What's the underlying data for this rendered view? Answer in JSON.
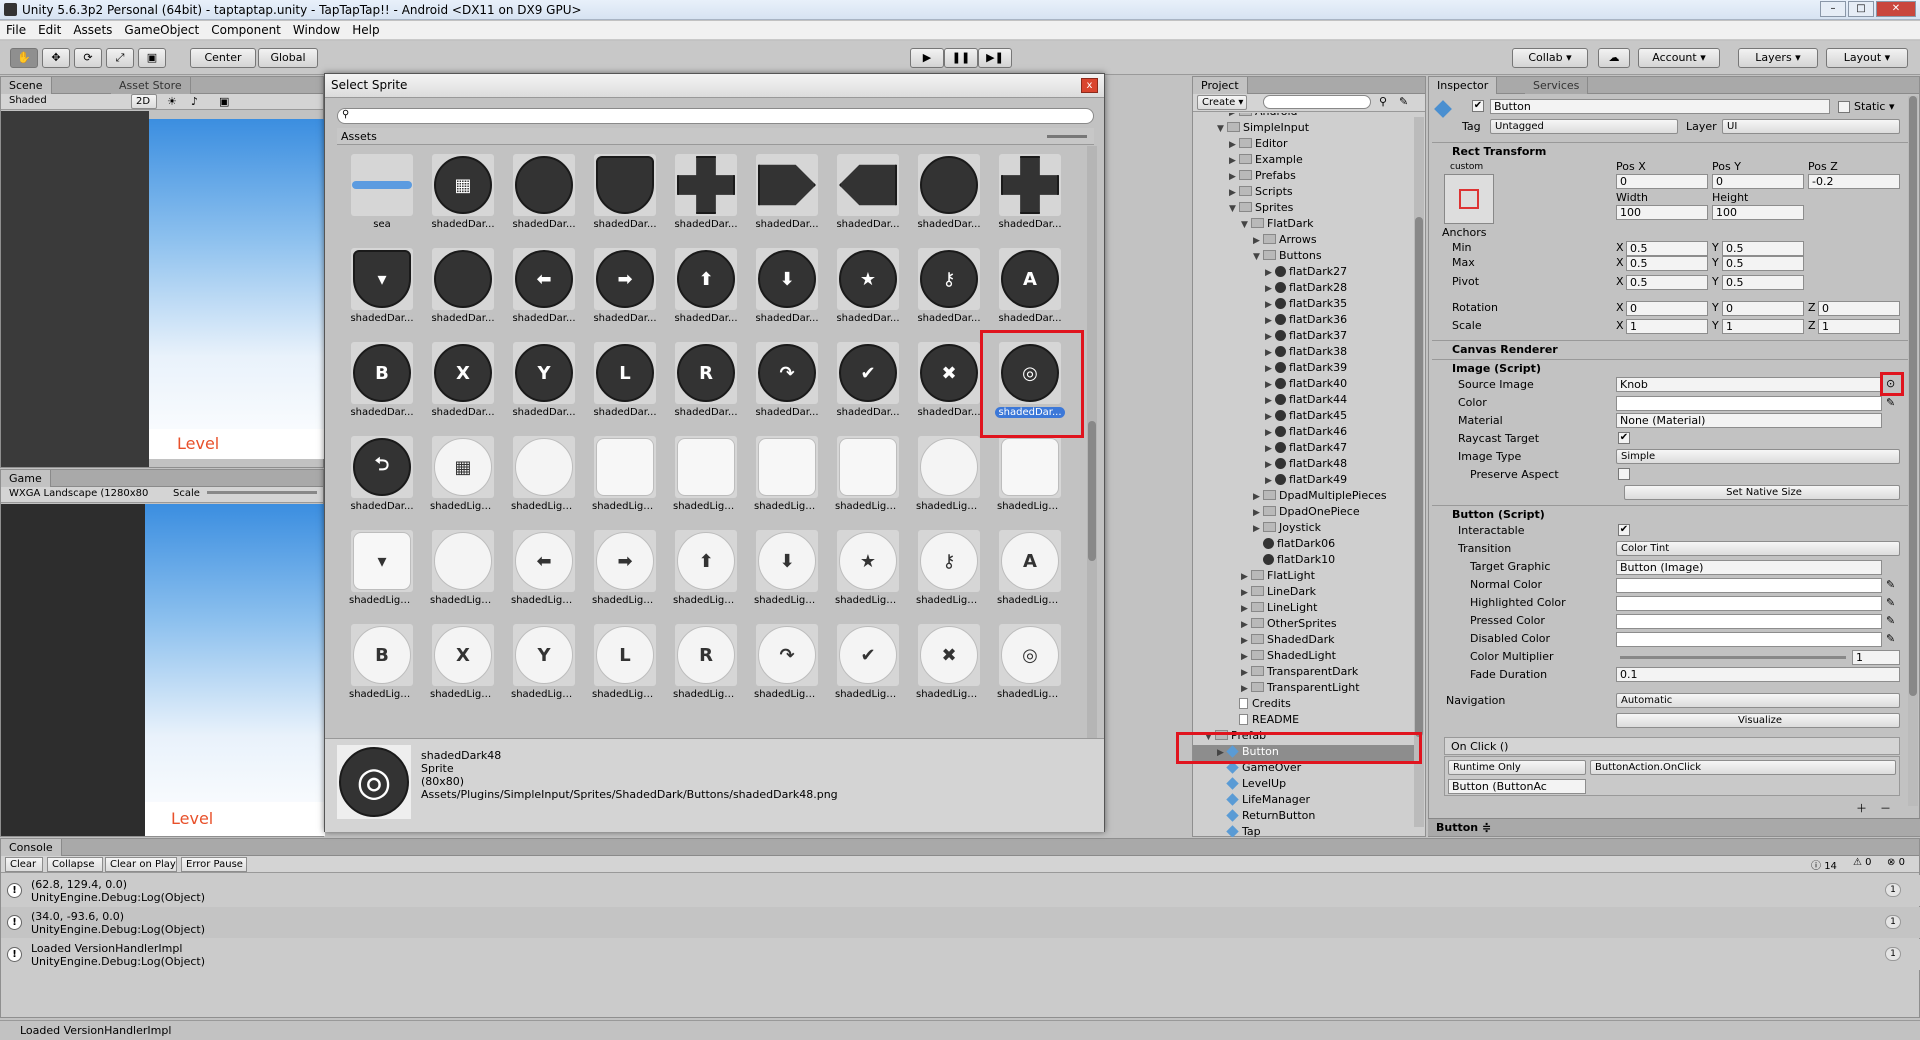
{
  "window": {
    "title": "Unity 5.6.3p2 Personal (64bit) - taptaptap.unity - TapTapTap!! - Android <DX11 on DX9 GPU>",
    "min": "–",
    "max": "□",
    "close": "✕"
  },
  "menu": [
    "File",
    "Edit",
    "Assets",
    "GameObject",
    "Component",
    "Window",
    "Help"
  ],
  "toolbar": {
    "center": "Center",
    "global": "Global",
    "collab": "Collab ▾",
    "cloud": "☁",
    "account": "Account ▾",
    "layers": "Layers ▾",
    "layout": "Layout ▾",
    "play": "▶",
    "pause": "❚❚",
    "step": "▶❚"
  },
  "scene": {
    "tab": "Scene",
    "asset_store": "Asset Store",
    "shaded": "Shaded",
    "mode2d": "2D",
    "level": "Level"
  },
  "game": {
    "tab": "Game",
    "aspect": "WXGA Landscape (1280x80",
    "scale": "Scale",
    "level": "Level"
  },
  "dialog": {
    "title": "Select Sprite",
    "close": "x",
    "assets_tab": "Assets",
    "preview_name": "shadedDark48",
    "preview_type": "Sprite",
    "preview_size": "(80x80)",
    "preview_path": "Assets/Plugins/SimpleInput/Sprites/ShadedDark/Buttons/shadedDark48.png",
    "items": [
      {
        "label": "sea",
        "kind": "bar"
      },
      {
        "label": "shadedDar...",
        "kind": "dark",
        "g": "▦"
      },
      {
        "label": "shadedDar...",
        "kind": "dark",
        "g": ""
      },
      {
        "label": "shadedDar...",
        "kind": "darkshield",
        "g": ""
      },
      {
        "label": "shadedDar...",
        "kind": "darkplus",
        "g": ""
      },
      {
        "label": "shadedDar...",
        "kind": "darkarrowR",
        "g": ""
      },
      {
        "label": "shadedDar...",
        "kind": "darkarrowL",
        "g": ""
      },
      {
        "label": "shadedDar...",
        "kind": "dark",
        "g": ""
      },
      {
        "label": "shadedDar...",
        "kind": "darkplus",
        "g": ""
      },
      {
        "label": "shadedDar...",
        "kind": "darkshield",
        "g": "▾"
      },
      {
        "label": "shadedDar...",
        "kind": "dark",
        "g": ""
      },
      {
        "label": "shadedDar...",
        "kind": "dark",
        "g": "⬅"
      },
      {
        "label": "shadedDar...",
        "kind": "dark",
        "g": "➡"
      },
      {
        "label": "shadedDar...",
        "kind": "dark",
        "g": "⬆"
      },
      {
        "label": "shadedDar...",
        "kind": "dark",
        "g": "⬇"
      },
      {
        "label": "shadedDar...",
        "kind": "dark",
        "g": "★"
      },
      {
        "label": "shadedDar...",
        "kind": "dark",
        "g": "⚷"
      },
      {
        "label": "shadedDar...",
        "kind": "dark",
        "g": "A"
      },
      {
        "label": "shadedDar...",
        "kind": "dark",
        "g": "B"
      },
      {
        "label": "shadedDar...",
        "kind": "dark",
        "g": "X"
      },
      {
        "label": "shadedDar...",
        "kind": "dark",
        "g": "Y"
      },
      {
        "label": "shadedDar...",
        "kind": "dark",
        "g": "L"
      },
      {
        "label": "shadedDar...",
        "kind": "dark",
        "g": "R"
      },
      {
        "label": "shadedDar...",
        "kind": "dark",
        "g": "↷"
      },
      {
        "label": "shadedDar...",
        "kind": "dark",
        "g": "✔"
      },
      {
        "label": "shadedDar...",
        "kind": "dark",
        "g": "✖"
      },
      {
        "label": "shadedDar...",
        "kind": "dark",
        "g": "◎",
        "selected": true
      },
      {
        "label": "shadedDar...",
        "kind": "dark",
        "g": "⮌"
      },
      {
        "label": "shadedLigh...",
        "kind": "light",
        "g": "▦"
      },
      {
        "label": "shadedLigh...",
        "kind": "light",
        "g": ""
      },
      {
        "label": "shadedLigh...",
        "kind": "lightshape",
        "g": ""
      },
      {
        "label": "shadedLigh...",
        "kind": "lightshape",
        "g": ""
      },
      {
        "label": "shadedLigh...",
        "kind": "lightshape",
        "g": ""
      },
      {
        "label": "shadedLigh...",
        "kind": "lightshape",
        "g": ""
      },
      {
        "label": "shadedLigh...",
        "kind": "light",
        "g": ""
      },
      {
        "label": "shadedLigh...",
        "kind": "lightshape",
        "g": ""
      },
      {
        "label": "shadedLigh...",
        "kind": "lightshape",
        "g": "▾"
      },
      {
        "label": "shadedLigh...",
        "kind": "light",
        "g": ""
      },
      {
        "label": "shadedLigh...",
        "kind": "light",
        "g": "⬅"
      },
      {
        "label": "shadedLigh...",
        "kind": "light",
        "g": "➡"
      },
      {
        "label": "shadedLigh...",
        "kind": "light",
        "g": "⬆"
      },
      {
        "label": "shadedLigh...",
        "kind": "light",
        "g": "⬇"
      },
      {
        "label": "shadedLigh...",
        "kind": "light",
        "g": "★"
      },
      {
        "label": "shadedLigh...",
        "kind": "light",
        "g": "⚷"
      },
      {
        "label": "shadedLigh...",
        "kind": "light",
        "g": "A"
      },
      {
        "label": "shadedLigh...",
        "kind": "light",
        "g": "B"
      },
      {
        "label": "shadedLigh...",
        "kind": "light",
        "g": "X"
      },
      {
        "label": "shadedLigh...",
        "kind": "light",
        "g": "Y"
      },
      {
        "label": "shadedLigh...",
        "kind": "light",
        "g": "L"
      },
      {
        "label": "shadedLigh...",
        "kind": "light",
        "g": "R"
      },
      {
        "label": "shadedLigh...",
        "kind": "light",
        "g": "↷"
      },
      {
        "label": "shadedLigh...",
        "kind": "light",
        "g": "✔"
      },
      {
        "label": "shadedLigh...",
        "kind": "light",
        "g": "✖"
      },
      {
        "label": "shadedLigh...",
        "kind": "light",
        "g": "◎"
      }
    ]
  },
  "project": {
    "tab": "Project",
    "create": "Create ▾",
    "rows": [
      {
        "t": "Android",
        "d": 3,
        "k": "folder"
      },
      {
        "t": "SimpleInput",
        "d": 2,
        "k": "folder",
        "open": true
      },
      {
        "t": "Editor",
        "d": 3,
        "k": "folder"
      },
      {
        "t": "Example",
        "d": 3,
        "k": "folder"
      },
      {
        "t": "Prefabs",
        "d": 3,
        "k": "folder"
      },
      {
        "t": "Scripts",
        "d": 3,
        "k": "folder"
      },
      {
        "t": "Sprites",
        "d": 3,
        "k": "folder",
        "open": true
      },
      {
        "t": "FlatDark",
        "d": 4,
        "k": "folder",
        "open": true
      },
      {
        "t": "Arrows",
        "d": 5,
        "k": "folder"
      },
      {
        "t": "Buttons",
        "d": 5,
        "k": "folder",
        "open": true
      },
      {
        "t": "flatDark27",
        "d": 6,
        "k": "sprite"
      },
      {
        "t": "flatDark28",
        "d": 6,
        "k": "sprite"
      },
      {
        "t": "flatDark35",
        "d": 6,
        "k": "sprite"
      },
      {
        "t": "flatDark36",
        "d": 6,
        "k": "sprite"
      },
      {
        "t": "flatDark37",
        "d": 6,
        "k": "sprite"
      },
      {
        "t": "flatDark38",
        "d": 6,
        "k": "sprite"
      },
      {
        "t": "flatDark39",
        "d": 6,
        "k": "sprite"
      },
      {
        "t": "flatDark40",
        "d": 6,
        "k": "sprite"
      },
      {
        "t": "flatDark44",
        "d": 6,
        "k": "sprite"
      },
      {
        "t": "flatDark45",
        "d": 6,
        "k": "sprite"
      },
      {
        "t": "flatDark46",
        "d": 6,
        "k": "sprite"
      },
      {
        "t": "flatDark47",
        "d": 6,
        "k": "sprite"
      },
      {
        "t": "flatDark48",
        "d": 6,
        "k": "sprite"
      },
      {
        "t": "flatDark49",
        "d": 6,
        "k": "sprite"
      },
      {
        "t": "DpadMultiplePieces",
        "d": 5,
        "k": "folder"
      },
      {
        "t": "DpadOnePiece",
        "d": 5,
        "k": "folder"
      },
      {
        "t": "Joystick",
        "d": 5,
        "k": "folder"
      },
      {
        "t": "flatDark06",
        "d": 5,
        "k": "sprite"
      },
      {
        "t": "flatDark10",
        "d": 5,
        "k": "sprite"
      },
      {
        "t": "FlatLight",
        "d": 4,
        "k": "folder"
      },
      {
        "t": "LineDark",
        "d": 4,
        "k": "folder"
      },
      {
        "t": "LineLight",
        "d": 4,
        "k": "folder"
      },
      {
        "t": "OtherSprites",
        "d": 4,
        "k": "folder"
      },
      {
        "t": "ShadedDark",
        "d": 4,
        "k": "folder"
      },
      {
        "t": "ShadedLight",
        "d": 4,
        "k": "folder"
      },
      {
        "t": "TransparentDark",
        "d": 4,
        "k": "folder"
      },
      {
        "t": "TransparentLight",
        "d": 4,
        "k": "folder"
      },
      {
        "t": "Credits",
        "d": 3,
        "k": "doc"
      },
      {
        "t": "README",
        "d": 3,
        "k": "doc"
      },
      {
        "t": "Prefab",
        "d": 1,
        "k": "folder",
        "open": true
      },
      {
        "t": "Button",
        "d": 2,
        "k": "cube",
        "selected": true
      },
      {
        "t": "GameOver",
        "d": 2,
        "k": "cube"
      },
      {
        "t": "LevelUp",
        "d": 2,
        "k": "cube"
      },
      {
        "t": "LifeManager",
        "d": 2,
        "k": "cube"
      },
      {
        "t": "ReturnButton",
        "d": 2,
        "k": "cube"
      },
      {
        "t": "Tap",
        "d": 2,
        "k": "cube"
      }
    ]
  },
  "inspector": {
    "tab": "Inspector",
    "services": "Services",
    "name": "Button",
    "static": "Static ▾",
    "tag_label": "Tag",
    "tag": "Untagged",
    "layer_label": "Layer",
    "layer": "UI",
    "rect": "Rect Transform",
    "custom": "custom",
    "posx": "Pos X",
    "posy": "Pos Y",
    "posz": "Pos Z",
    "posx_v": "0",
    "posy_v": "0",
    "posz_v": "-0.2",
    "width": "Width",
    "height": "Height",
    "width_v": "100",
    "height_v": "100",
    "anchors": "Anchors",
    "min": "Min",
    "max": "Max",
    "pivot": "Pivot",
    "min_x": "0.5",
    "min_y": "0.5",
    "max_x": "0.5",
    "max_y": "0.5",
    "pivot_x": "0.5",
    "pivot_y": "0.5",
    "rotation": "Rotation",
    "scale": "Scale",
    "rot": [
      "0",
      "0",
      "0"
    ],
    "scl": [
      "1",
      "1",
      "1"
    ],
    "canvas_renderer": "Canvas Renderer",
    "image": "Image (Script)",
    "source_image": "Source Image",
    "source_v": "Knob",
    "color": "Color",
    "material": "Material",
    "material_v": "None (Material)",
    "raycast": "Raycast Target",
    "image_type": "Image Type",
    "image_type_v": "Simple",
    "preserve": "Preserve Aspect",
    "native": "Set Native Size",
    "button": "Button (Script)",
    "interactable": "Interactable",
    "transition": "Transition",
    "transition_v": "Color Tint",
    "target_graphic": "Target Graphic",
    "target_v": "Button (Image)",
    "normal": "Normal Color",
    "highlighted": "Highlighted Color",
    "pressed": "Pressed Color",
    "disabled": "Disabled Color",
    "multiplier": "Color Multiplier",
    "multiplier_v": "1",
    "fade": "Fade Duration",
    "fade_v": "0.1",
    "navigation": "Navigation",
    "navigation_v": "Automatic",
    "visualize": "Visualize",
    "onclick": "On Click ()",
    "runtime": "Runtime Only",
    "handler": "ButtonAction.OnClick",
    "obj": "Button (ButtonAc",
    "footer": "Button ≑",
    "x": "X",
    "y": "Y",
    "z": "Z"
  },
  "console": {
    "tab": "Console",
    "clear": "Clear",
    "collapse": "Collapse",
    "clear_on_play": "Clear on Play",
    "error_pause": "Error Pause",
    "counts": [
      "14",
      "0",
      "0"
    ],
    "rows": [
      {
        "l1": "(62.8, 129.4, 0.0)",
        "l2": "UnityEngine.Debug:Log(Object)",
        "n": "1"
      },
      {
        "l1": "(34.0, -93.6, 0.0)",
        "l2": "UnityEngine.Debug:Log(Object)",
        "n": "1"
      },
      {
        "l1": "Loaded VersionHandlerImpl",
        "l2": "UnityEngine.Debug:Log(Object)",
        "n": "1"
      }
    ],
    "status": "Loaded VersionHandlerImpl"
  }
}
